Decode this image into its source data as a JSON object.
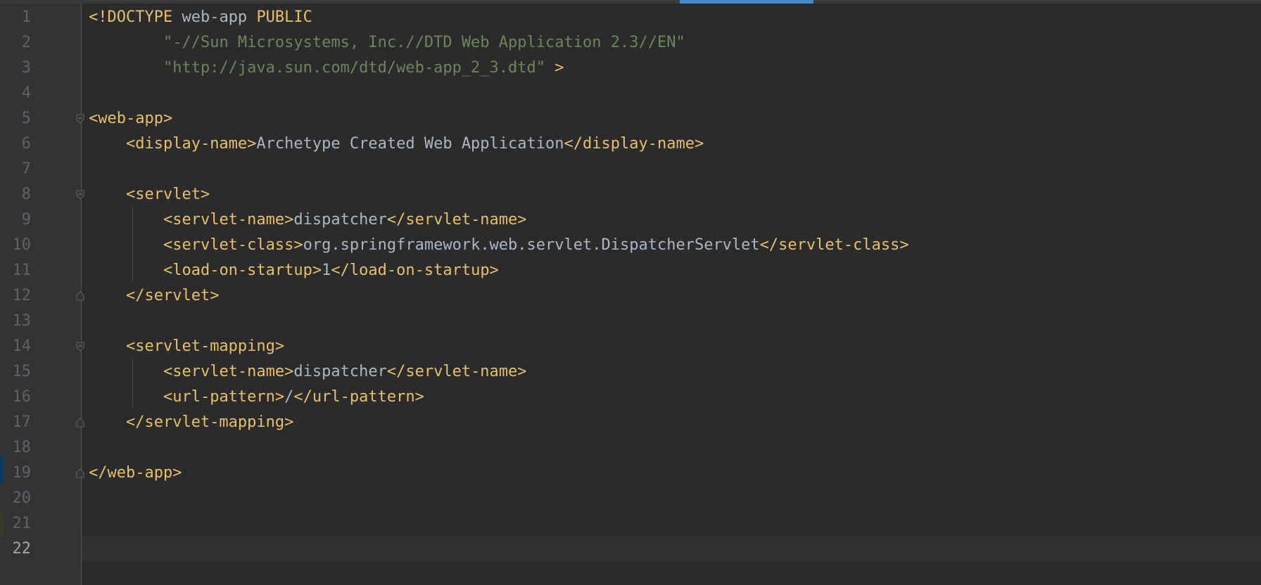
{
  "editor": {
    "line_numbers": [
      "1",
      "2",
      "3",
      "4",
      "5",
      "6",
      "7",
      "8",
      "9",
      "10",
      "11",
      "12",
      "13",
      "14",
      "15",
      "16",
      "17",
      "18",
      "19",
      "20",
      "21",
      "22"
    ],
    "current_line": "22"
  },
  "code": {
    "l1_open": "<!DOCTYPE",
    "l1_name": " web-app ",
    "l1_public": "PUBLIC",
    "l2_indent": "        ",
    "l2_string": "\"-//Sun Microsystems, Inc.//DTD Web Application 2.3//EN\"",
    "l3_indent": "        ",
    "l3_string": "\"http://java.sun.com/dtd/web-app_2_3.dtd\"",
    "l3_close": " >",
    "l5_tag": "<web-app>",
    "l6_indent": "    ",
    "l6_open": "<display-name>",
    "l6_text": "Archetype Created Web Application",
    "l6_close": "</display-name>",
    "l8_indent": "    ",
    "l8_tag": "<servlet>",
    "l9_indent": "        ",
    "l9_open": "<servlet-name>",
    "l9_text": "dispatcher",
    "l9_close": "</servlet-name>",
    "l10_indent": "        ",
    "l10_open": "<servlet-class>",
    "l10_text": "org.springframework.web.servlet.DispatcherServlet",
    "l10_close": "</servlet-class>",
    "l11_indent": "        ",
    "l11_open": "<load-on-startup>",
    "l11_text": "1",
    "l11_close": "</load-on-startup>",
    "l12_indent": "    ",
    "l12_tag": "</servlet>",
    "l14_indent": "    ",
    "l14_tag": "<servlet-mapping>",
    "l15_indent": "        ",
    "l15_open": "<servlet-name>",
    "l15_text": "dispatcher",
    "l15_close": "</servlet-name>",
    "l16_indent": "        ",
    "l16_open": "<url-pattern>",
    "l16_text": "/",
    "l16_close": "</url-pattern>",
    "l17_indent": "    ",
    "l17_tag": "</servlet-mapping>",
    "l19_tag": "</web-app>"
  },
  "colors": {
    "background": "#2b2b2b",
    "gutter": "#313335",
    "line_number": "#606366",
    "tag": "#e8bf6a",
    "string": "#6a8759",
    "text": "#a9b7c6",
    "tab_indicator": "#4a88c7"
  }
}
